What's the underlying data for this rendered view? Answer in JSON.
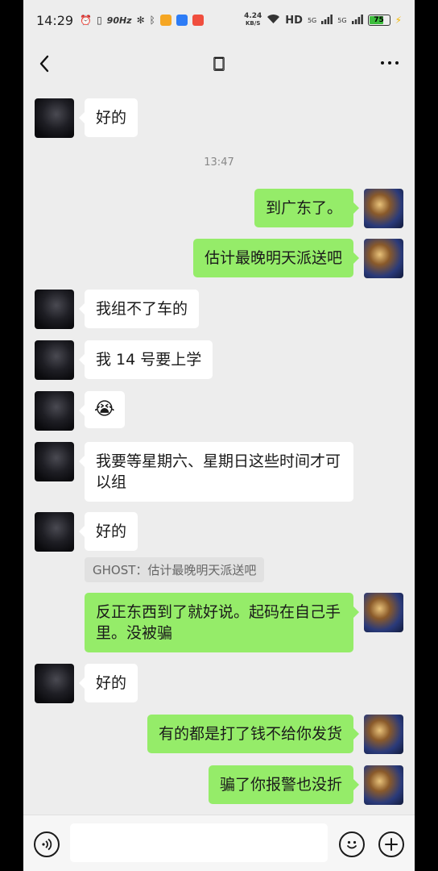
{
  "status_bar": {
    "time": "14:29",
    "refresh_rate": "90Hz",
    "net_speed_value": "4.24",
    "net_speed_unit": "KB/S",
    "hd_label": "HD",
    "signal1_label": "5G",
    "signal2_label": "5G",
    "battery_level": "75",
    "battery_fraction": 0.75,
    "battery_color": "#3dbd3d"
  },
  "nav": {
    "title": "🀆",
    "back_icon": "chevron-left-icon",
    "more_icon": "more-dots-icon"
  },
  "messages": [
    {
      "side": "left",
      "text": "好的"
    },
    {
      "type": "time",
      "text": "13:47"
    },
    {
      "side": "right",
      "text": "到广东了。"
    },
    {
      "side": "right",
      "text": "估计最晚明天派送吧"
    },
    {
      "side": "left",
      "text": "我组不了车的"
    },
    {
      "side": "left",
      "text": "我 14 号要上学"
    },
    {
      "side": "left",
      "text": "😭"
    },
    {
      "side": "left",
      "text": "我要等星期六、星期日这些时间才可以组"
    },
    {
      "side": "left",
      "text": "好的"
    },
    {
      "type": "quote",
      "text": "GHOST：估计最晚明天派送吧"
    },
    {
      "side": "right",
      "text": "反正东西到了就好说。起码在自己手里。没被骗"
    },
    {
      "side": "left",
      "text": "好的"
    },
    {
      "side": "right",
      "text": "有的都是打了钱不给你发货"
    },
    {
      "side": "right",
      "text": "骗了你报警也没折"
    }
  ],
  "input_bar": {
    "voice_icon": "voice-icon",
    "emoji_icon": "emoji-icon",
    "plus_icon": "plus-icon",
    "placeholder": ""
  },
  "colors": {
    "chat_bg": "#ededed",
    "my_bubble": "#95ec69",
    "their_bubble": "#ffffff"
  }
}
